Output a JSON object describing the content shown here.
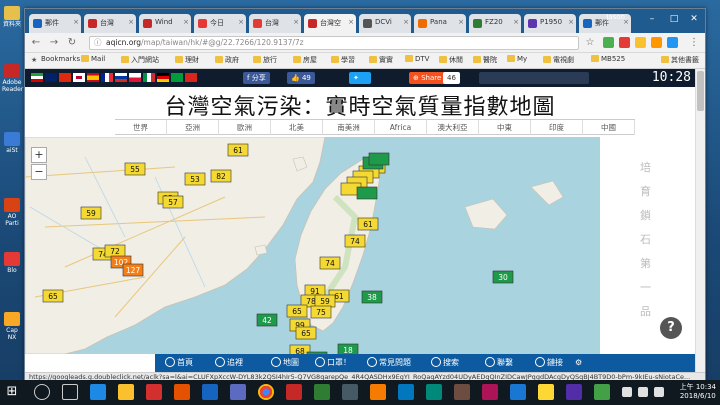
{
  "desktop": {
    "icons": [
      {
        "label": "資料夾"
      },
      {
        "label": "Adobe Reader"
      },
      {
        "label": "aiSt"
      },
      {
        "label": "AO Parti"
      },
      {
        "label": "Blo"
      },
      {
        "label": "Cap NX"
      }
    ]
  },
  "browser": {
    "user": "Jason",
    "tabs": [
      {
        "label": "郵件",
        "color": "#1565c0"
      },
      {
        "label": "台灣",
        "color": "#c62828"
      },
      {
        "label": "Wind",
        "color": "#c62828"
      },
      {
        "label": "今日",
        "color": "#e53935"
      },
      {
        "label": "台灣",
        "color": "#e53935"
      },
      {
        "label": "台灣空",
        "color": "#c62828",
        "active": true
      },
      {
        "label": "DCVi",
        "color": "#555"
      },
      {
        "label": "Pana",
        "color": "#ef6c00"
      },
      {
        "label": "FZ20",
        "color": "#2e7d32"
      },
      {
        "label": "P1950",
        "color": "#5e35b1"
      },
      {
        "label": "郵件",
        "color": "#1565c0"
      }
    ],
    "url_host": "aqicn.org",
    "url_path": "/map/taiwan/hk/#@g/22.7266/120.9137/7z",
    "bookmarks": [
      "Bookmarks",
      "Mail",
      "入門網站",
      "理財",
      "政府",
      "旅行",
      "房屋",
      "學習",
      "實實",
      "DTV",
      "休閒",
      "醫院",
      "My",
      "電視劇",
      "MB525"
    ],
    "bookmarks_other": "其他書籤",
    "status_url": "https://googleads.g.doubleclick.net/aclk?sa=l&ai=CLUFXpXccW-DYL83k2QSI4hIr5-Q7VG8qarepQe_4R4QASDHx9EgYI_RoQagAYzd04UDyAEDqQInZIDCawJPqgdDAcgDyQSqBJ4BT9D0-bPm-9kIEu-sNiotaCe..."
  },
  "page": {
    "share_fb": "分享",
    "like_count": "49",
    "share_label": "Share",
    "share_count": "46",
    "clock": "10:28",
    "title": "台灣空氣污染：實時空氣質量指數地圖",
    "region_tabs": [
      "世界",
      "亞洲",
      "歐洲",
      "北美",
      "南美洲",
      "Africa",
      "澳大利亞",
      "中東",
      "印度",
      "中國"
    ],
    "zoom_in": "+",
    "zoom_out": "−",
    "ad_chars": [
      "培",
      "育",
      "鎖",
      "石",
      "第",
      "一",
      "品"
    ],
    "help": "?",
    "bottom_nav": [
      "首頁",
      "追裡",
      "地圖",
      "口罩！",
      "常見問題",
      "搜索",
      "聯繫",
      "鏈接",
      "⚙"
    ]
  },
  "map_markers": [
    {
      "v": "61",
      "c": "yellow"
    },
    {
      "v": "55",
      "c": "yellow"
    },
    {
      "v": "53",
      "c": "yellow"
    },
    {
      "v": "82",
      "c": "yellow"
    },
    {
      "v": "95",
      "c": "yellow"
    },
    {
      "v": "57",
      "c": "yellow"
    },
    {
      "v": "59",
      "c": "yellow"
    },
    {
      "v": "74",
      "c": "yellow"
    },
    {
      "v": "72",
      "c": "yellow"
    },
    {
      "v": "102",
      "c": "orange"
    },
    {
      "v": "127",
      "c": "orange"
    },
    {
      "v": "65",
      "c": "yellow"
    },
    {
      "v": "61",
      "c": "yellow"
    },
    {
      "v": "74",
      "c": "yellow"
    },
    {
      "v": "74",
      "c": "yellow"
    },
    {
      "v": "91",
      "c": "yellow"
    },
    {
      "v": "61",
      "c": "yellow"
    },
    {
      "v": "78",
      "c": "yellow"
    },
    {
      "v": "59",
      "c": "yellow"
    },
    {
      "v": "65",
      "c": "yellow"
    },
    {
      "v": "75",
      "c": "yellow"
    },
    {
      "v": "99",
      "c": "yellow"
    },
    {
      "v": "65",
      "c": "yellow"
    },
    {
      "v": "68",
      "c": "yellow"
    },
    {
      "v": "68",
      "c": "yellow"
    },
    {
      "v": "68",
      "c": "yellow"
    },
    {
      "v": "38",
      "c": "green"
    },
    {
      "v": "42",
      "c": "green"
    },
    {
      "v": "18",
      "c": "green"
    },
    {
      "v": "38",
      "c": "green"
    },
    {
      "v": "30",
      "c": "green"
    },
    {
      "v": "38",
      "c": "green"
    },
    {
      "v": "42",
      "c": "green"
    }
  ],
  "colors": {
    "good": "#1e9a4a",
    "moderate": "#f5d933",
    "usg": "#f57f17",
    "nav_blue": "#0d5aa0",
    "page_bar": "#0e1c2e"
  },
  "taskbar": {
    "clock_time": "上午 10:34",
    "clock_date": "2018/6/10"
  }
}
